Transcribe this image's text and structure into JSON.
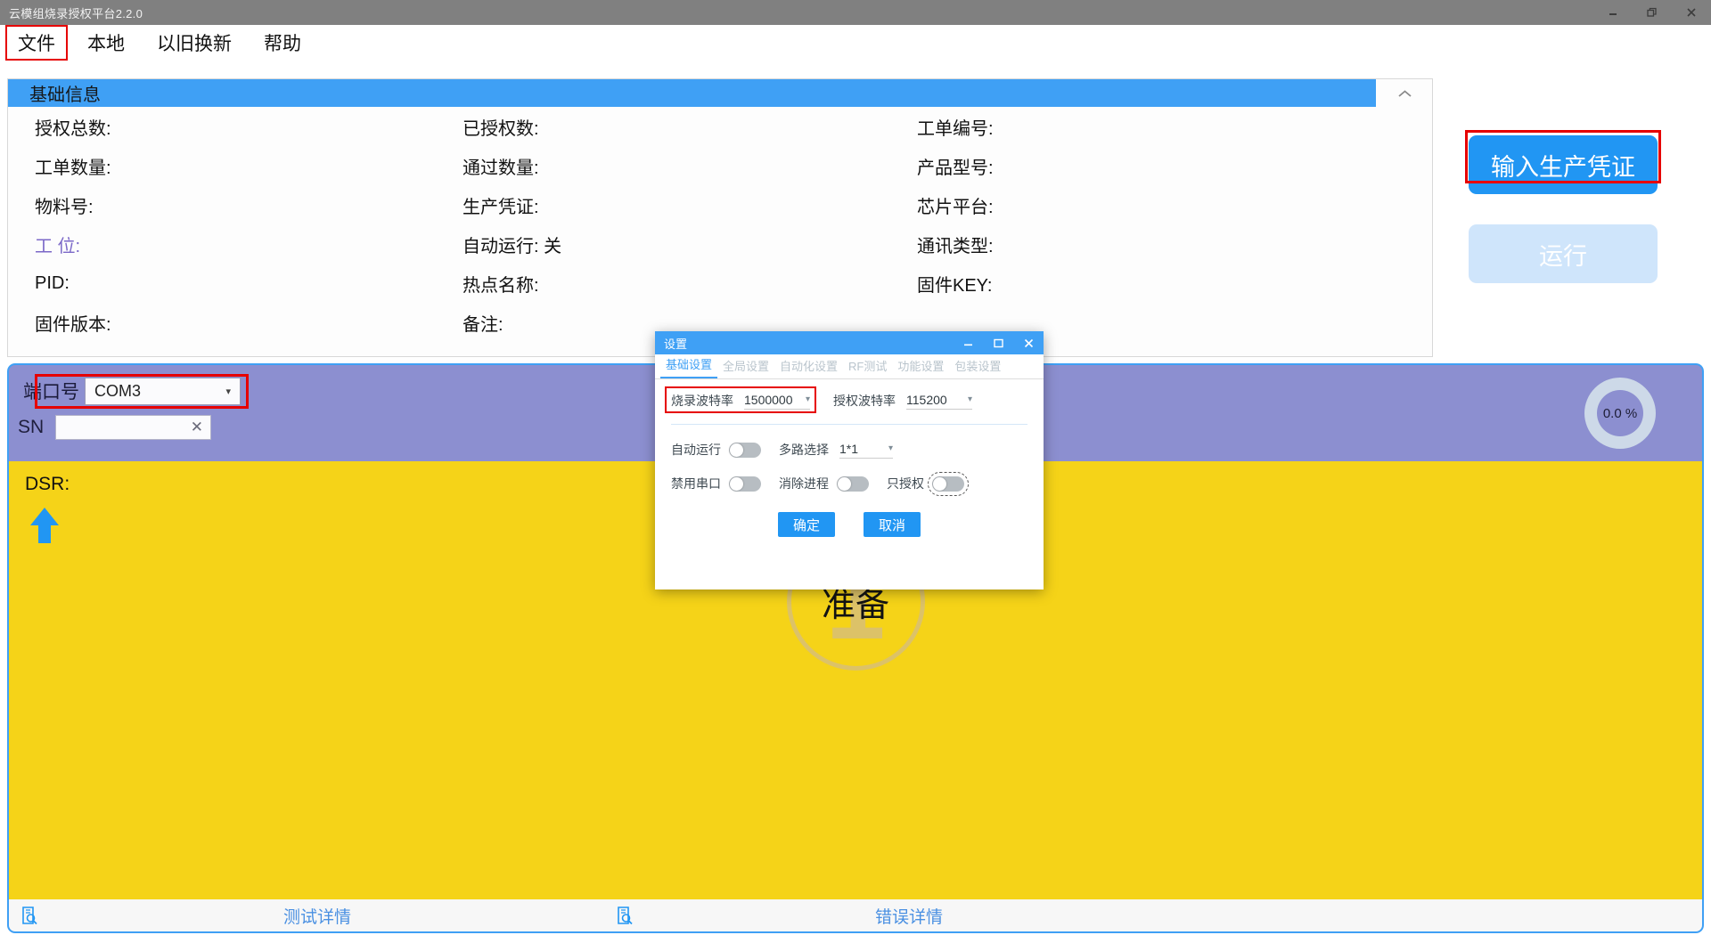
{
  "window": {
    "title": "云模组烧录授权平台2.2.0",
    "controls": [
      {
        "name": "minimize",
        "glyph": "minimize-icon"
      },
      {
        "name": "restore",
        "glyph": "restore-icon"
      },
      {
        "name": "close",
        "glyph": "close-icon"
      }
    ]
  },
  "menubar": {
    "items": [
      {
        "label": "文件",
        "highlighted": true
      },
      {
        "label": "本地",
        "highlighted": false
      },
      {
        "label": "以旧换新",
        "highlighted": false
      },
      {
        "label": "帮助",
        "highlighted": false
      }
    ]
  },
  "info_panel": {
    "header": "基础信息",
    "collapse_icon": "chevron-up-icon",
    "rows": [
      {
        "col1": "授权总数:",
        "col2": "已授权数:",
        "col3": "工单编号:"
      },
      {
        "col1": "工单数量:",
        "col2": "通过数量:",
        "col3": "产品型号:"
      },
      {
        "col1": "物料号:",
        "col2": "生产凭证:",
        "col3": "芯片平台:"
      },
      {
        "col1": "工 位:",
        "col2": "自动运行: 关",
        "col3": "通讯类型:"
      },
      {
        "col1": "PID:",
        "col2": "热点名称:",
        "col3": "固件KEY:"
      },
      {
        "col1": "固件版本:",
        "col2": "备注:",
        "col3": ""
      }
    ]
  },
  "actions": {
    "credential_button": "输入生产凭证",
    "run_button": "运行"
  },
  "toolbar": {
    "port_label": "端口号",
    "port_value": "COM3",
    "port_caret": "▾",
    "sn_label": "SN",
    "sn_value": "",
    "sn_placeholder": "",
    "sn_clear": "✕",
    "gauge_value": "0.0 %"
  },
  "workarea": {
    "dsr_label": "DSR:",
    "arrow_icon": "arrow-up-icon",
    "stage_number": "1",
    "stage_text": "准备"
  },
  "bottom_bar": {
    "test_detail_icon": "document-search-icon",
    "test_detail_label": "测试详情",
    "error_detail_icon": "document-search-icon",
    "error_detail_label": "错误详情"
  },
  "dialog": {
    "title": "设置",
    "controls": [
      {
        "name": "minimize",
        "glyph": "−"
      },
      {
        "name": "maximize",
        "glyph": "☐"
      },
      {
        "name": "close",
        "glyph": "✕"
      }
    ],
    "tabs": [
      {
        "label": "基础设置",
        "active": true
      },
      {
        "label": "全局设置",
        "active": false
      },
      {
        "label": "自动化设置",
        "active": false
      },
      {
        "label": "RF测试",
        "active": false
      },
      {
        "label": "功能设置",
        "active": false
      },
      {
        "label": "包装设置",
        "active": false
      }
    ],
    "fields": {
      "burn_baud_label": "烧录波特率",
      "burn_baud_value": "1500000",
      "auth_baud_label": "授权波特率",
      "auth_baud_value": "115200",
      "caret": "▾"
    },
    "toggles": {
      "auto_run_label": "自动运行",
      "multi_label": "多路选择",
      "multi_value": "1*1",
      "disable_serial_label": "禁用串口",
      "kill_process_label": "消除进程",
      "only_auth_label": "只授权"
    },
    "buttons": {
      "ok": "确定",
      "cancel": "取消"
    }
  },
  "colors": {
    "accent_blue": "#3fa0f5",
    "button_blue": "#2196f3",
    "highlight_red": "#e60000",
    "panel_periwinkle": "#8c8fd0",
    "work_yellow": "#f5d318",
    "titlebar_gray": "#808080",
    "label_purple": "#7b68c8"
  }
}
